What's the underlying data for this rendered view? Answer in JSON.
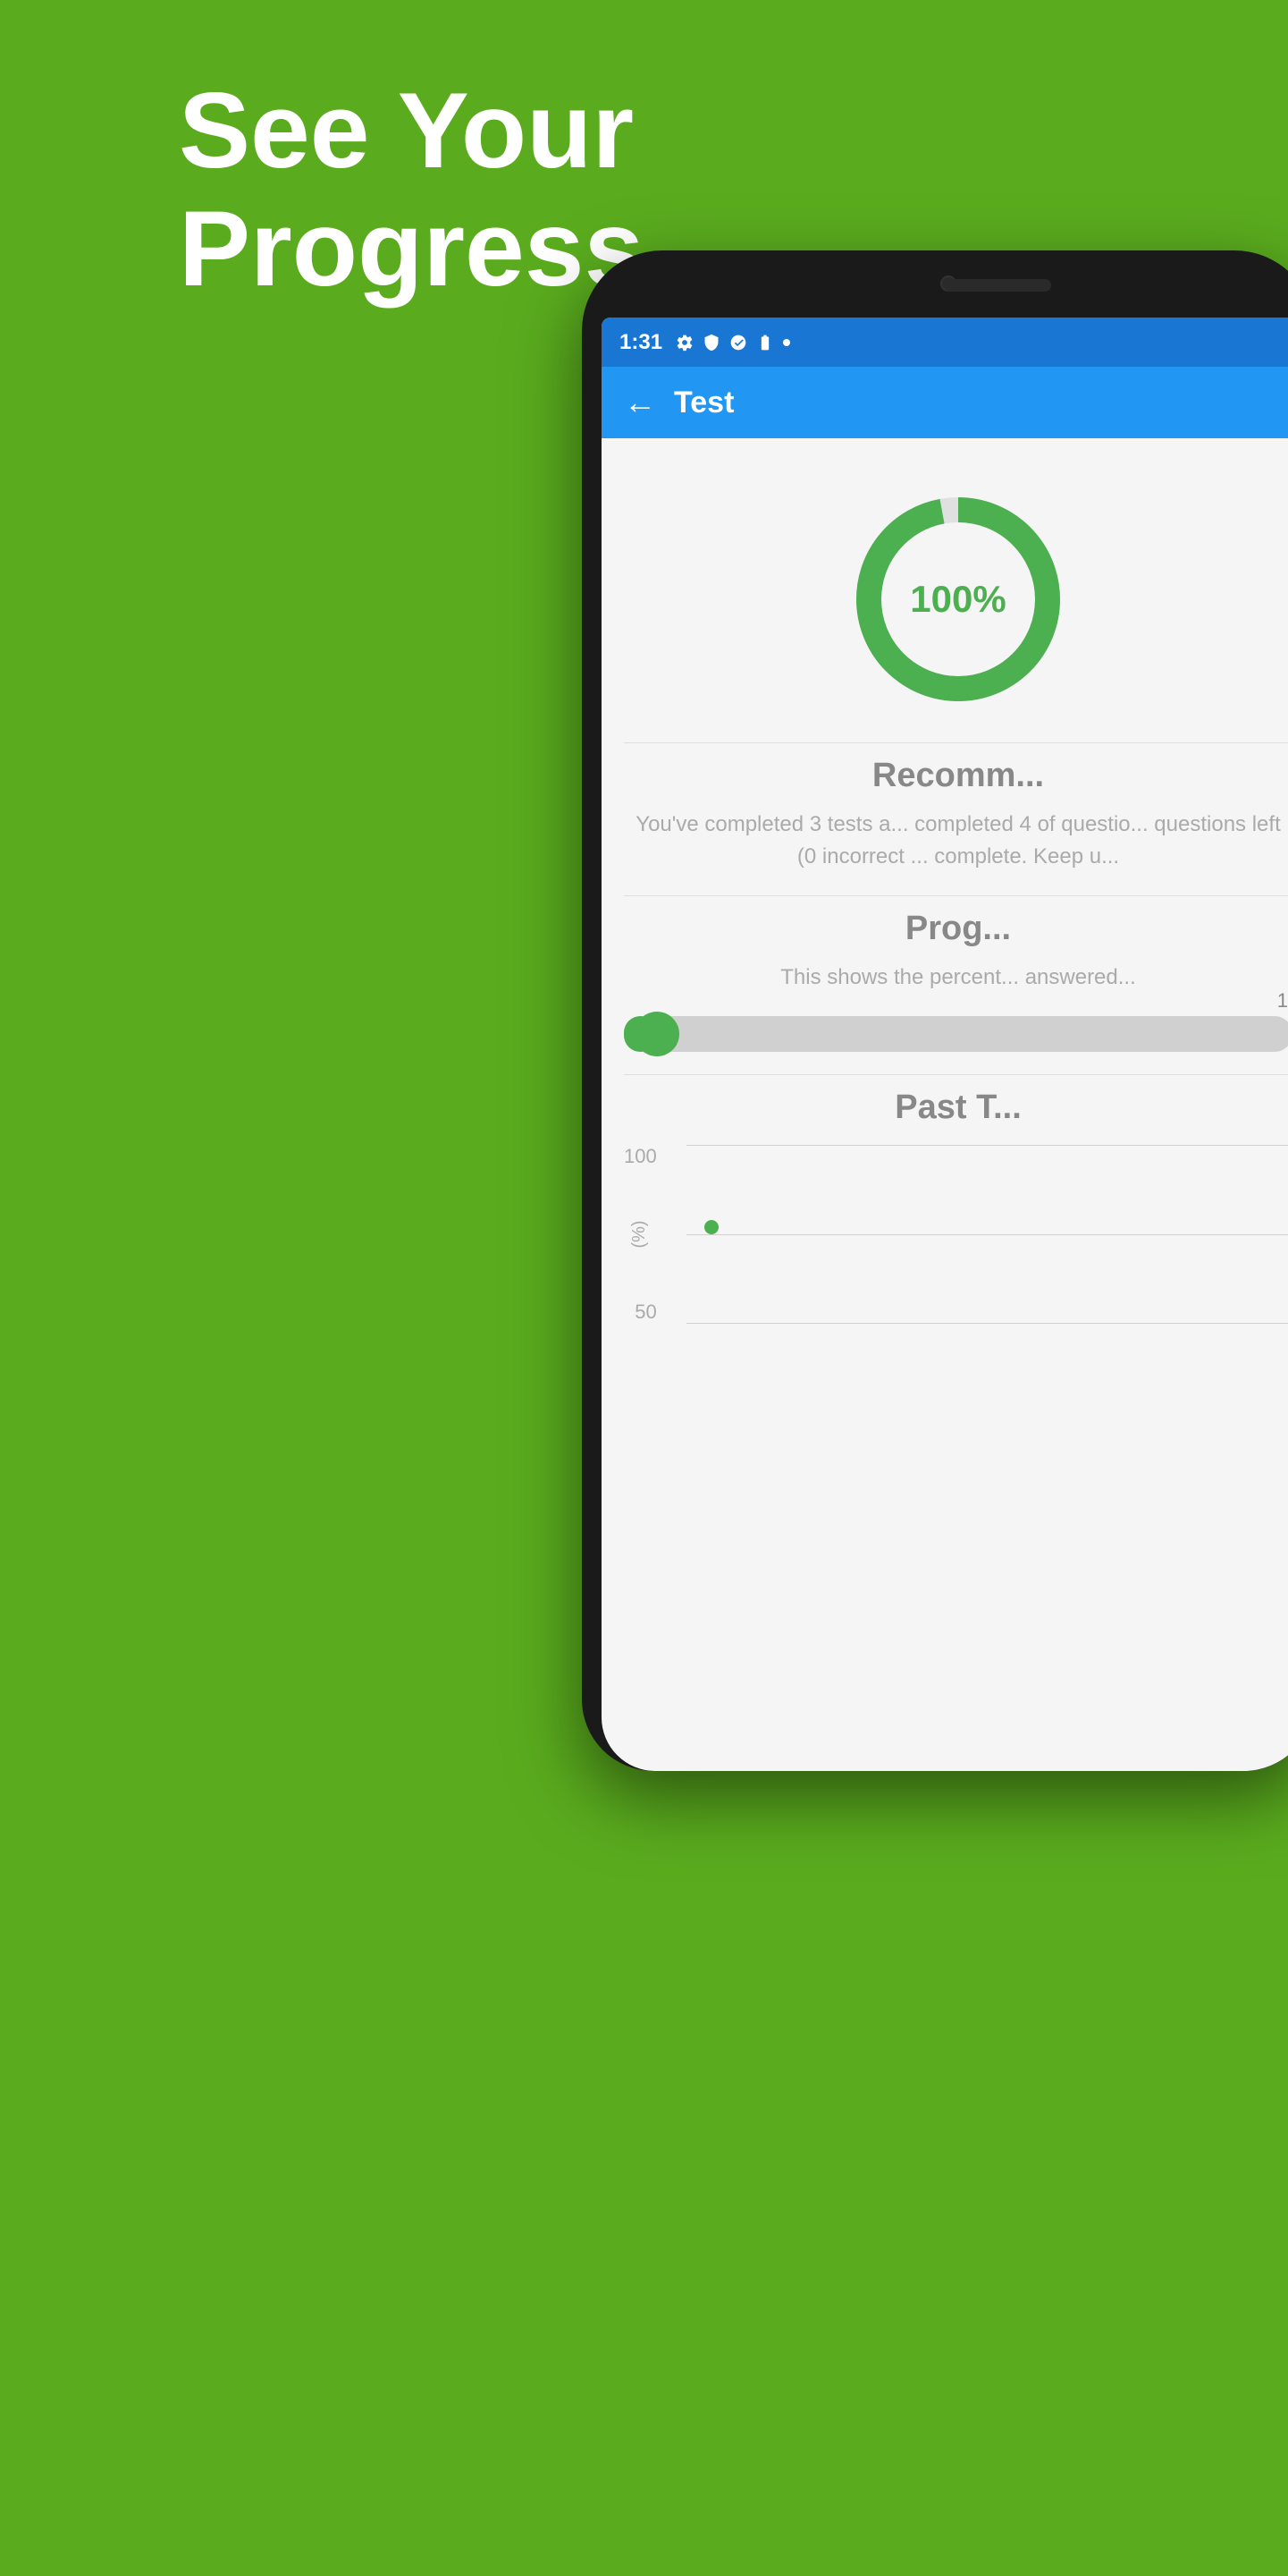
{
  "background": {
    "color": "#5aac1e"
  },
  "headline": {
    "line1": "See Your",
    "line2": "Progress"
  },
  "phone": {
    "status_bar": {
      "time": "1:31",
      "icons": [
        "gear",
        "shield",
        "at",
        "battery",
        "dot"
      ]
    },
    "app_bar": {
      "back_label": "←",
      "title": "Test"
    },
    "donut": {
      "percent": "100%",
      "value": 100
    },
    "recommendation": {
      "title": "Recomm...",
      "body": "You've completed 3 tests a... completed 4 of questio... questions left (0 incorrect ... complete. Keep u..."
    },
    "progress": {
      "title": "Prog...",
      "description": "This shows the percent... answered...",
      "bar_value": 5,
      "bar_label": "1"
    },
    "past_tests": {
      "title": "Past T...",
      "chart": {
        "y_labels": [
          "100",
          "50"
        ],
        "data_points": [
          {
            "x": 20,
            "y": 75
          }
        ]
      }
    }
  }
}
